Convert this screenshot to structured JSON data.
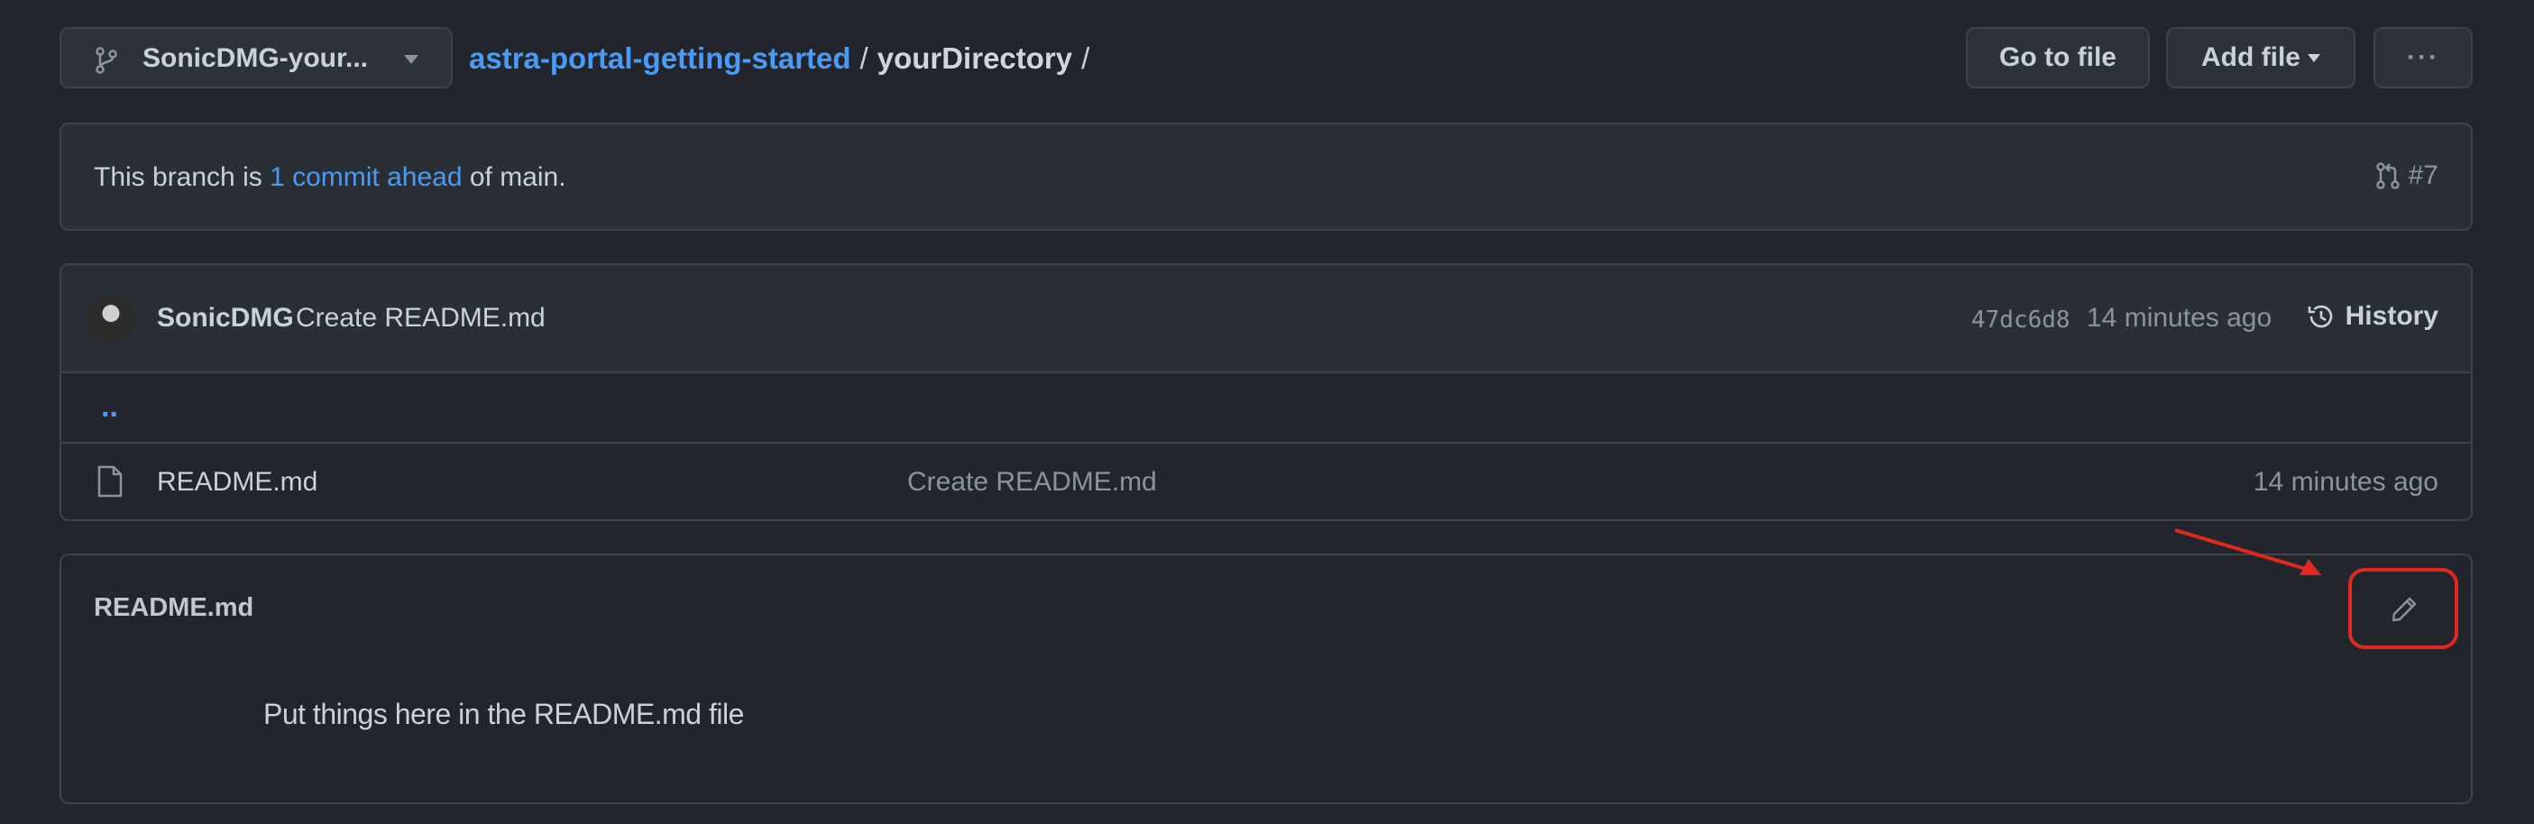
{
  "header": {
    "branch_name": "SonicDMG-your...",
    "repo_link": "astra-portal-getting-started",
    "separator": "/",
    "directory": "yourDirectory",
    "trailing_separator": "/",
    "go_to_file_label": "Go to file",
    "add_file_label": "Add file",
    "more_label": "···"
  },
  "branch_info": {
    "prefix": "This branch is ",
    "link": "1 commit ahead",
    "suffix": " of main.",
    "pr_number": "#7"
  },
  "latest_commit": {
    "author": "SonicDMG",
    "message": "Create README.md",
    "sha": "47dc6d8",
    "time": "14 minutes ago",
    "history_label": "History"
  },
  "files": {
    "parent_dir": "..",
    "rows": [
      {
        "name": "README.md",
        "commit_message": "Create README.md",
        "time": "14 minutes ago"
      }
    ]
  },
  "readme": {
    "title": "README.md",
    "body": "Put things here in the README.md file"
  },
  "colors": {
    "background": "#22262c",
    "link": "#4a9bf5",
    "annotation": "#e2291f"
  }
}
